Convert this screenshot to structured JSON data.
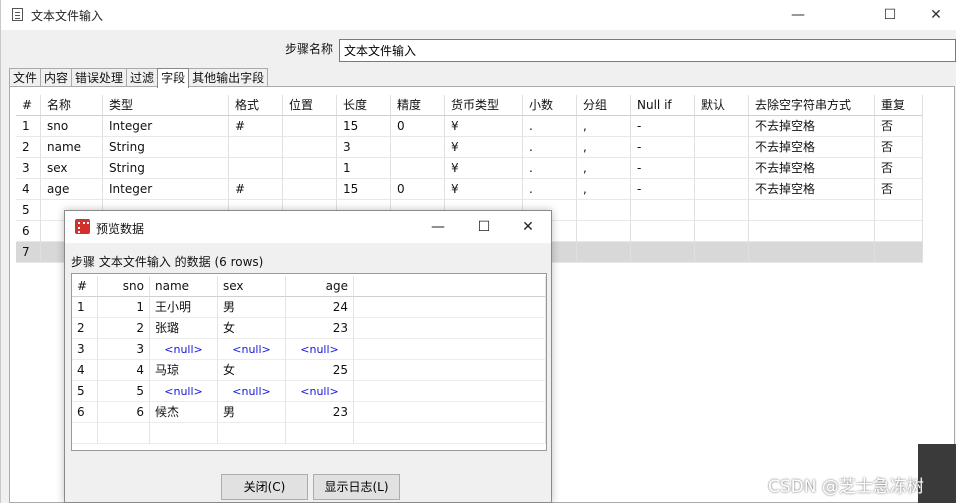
{
  "window": {
    "title": "文本文件输入",
    "minimize": "—",
    "maximize": "☐",
    "close": "✕"
  },
  "step_name": {
    "label": "步骤名称",
    "value": "文本文件输入"
  },
  "tabs": [
    "文件",
    "内容",
    "错误处理",
    "过滤",
    "字段",
    "其他输出字段"
  ],
  "fields_table": {
    "columns": [
      "#",
      "名称",
      "类型",
      "格式",
      "位置",
      "长度",
      "精度",
      "货币类型",
      "小数",
      "分组",
      "Null if",
      "默认",
      "去除空字符串方式",
      "重复"
    ],
    "rows": [
      [
        "1",
        "sno",
        "Integer",
        "#",
        "",
        "15",
        "0",
        "¥",
        ".",
        ",",
        "-",
        "",
        "不去掉空格",
        "否"
      ],
      [
        "2",
        "name",
        "String",
        "",
        "",
        "3",
        "",
        "¥",
        ".",
        ",",
        "-",
        "",
        "不去掉空格",
        "否"
      ],
      [
        "3",
        "sex",
        "String",
        "",
        "",
        "1",
        "",
        "¥",
        ".",
        ",",
        "-",
        "",
        "不去掉空格",
        "否"
      ],
      [
        "4",
        "age",
        "Integer",
        "#",
        "",
        "15",
        "0",
        "¥",
        ".",
        ",",
        "-",
        "",
        "不去掉空格",
        "否"
      ],
      [
        "5",
        "",
        "",
        "",
        "",
        "",
        "",
        "",
        "",
        "",
        "",
        "",
        "",
        ""
      ],
      [
        "6",
        "",
        "",
        "",
        "",
        "",
        "",
        "",
        "",
        "",
        "",
        "",
        "",
        ""
      ],
      [
        "7",
        "",
        "",
        "",
        "",
        "",
        "",
        "",
        "",
        "",
        "",
        "",
        "",
        ""
      ]
    ]
  },
  "preview": {
    "title": "预览数据",
    "caption": "步骤 文本文件输入 的数据  (6 rows)",
    "columns": [
      "#",
      "sno",
      "name",
      "sex",
      "age"
    ],
    "rows": [
      [
        "1",
        "1",
        "王小明",
        "男",
        "24"
      ],
      [
        "2",
        "2",
        "张璐",
        "女",
        "23"
      ],
      [
        "3",
        "3",
        "<null>",
        "<null>",
        "<null>"
      ],
      [
        "4",
        "4",
        "马琼",
        "女",
        "25"
      ],
      [
        "5",
        "5",
        "<null>",
        "<null>",
        "<null>"
      ],
      [
        "6",
        "6",
        "候杰",
        "男",
        "23"
      ]
    ],
    "close_button": "关闭(C)",
    "log_button": "显示日志(L)",
    "minimize": "—",
    "maximize": "☐",
    "close": "✕"
  },
  "watermark": "CSDN @芝士急冻树"
}
